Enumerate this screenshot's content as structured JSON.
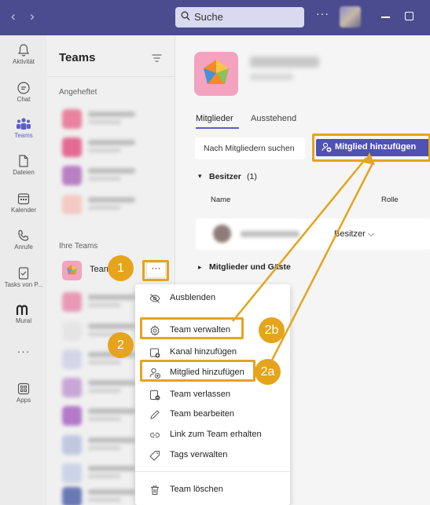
{
  "topbar": {
    "search_placeholder": "Suche",
    "more": "···"
  },
  "rail": {
    "items": [
      {
        "label": "Aktivität",
        "icon": "bell-icon"
      },
      {
        "label": "Chat",
        "icon": "chat-icon"
      },
      {
        "label": "Teams",
        "icon": "teams-icon"
      },
      {
        "label": "Dateien",
        "icon": "file-icon"
      },
      {
        "label": "Kalender",
        "icon": "calendar-icon"
      },
      {
        "label": "Anrufe",
        "icon": "phone-icon"
      },
      {
        "label": "Tasks von P...",
        "icon": "tasks-icon"
      },
      {
        "label": "Mural",
        "icon": "mural-icon"
      },
      {
        "label": "···",
        "icon": "more-icon"
      },
      {
        "label": "Apps",
        "icon": "apps-icon"
      }
    ]
  },
  "pane": {
    "title": "Teams",
    "pinned_label": "Angeheftet",
    "your_teams_label": "Ihre Teams",
    "selected_team": "Tean",
    "more_button": "···"
  },
  "main": {
    "tab_members": "Mitglieder",
    "tab_pending": "Ausstehend",
    "search_placeholder": "Nach Mitgliedern suchen",
    "add_member_button": "Mitglied hinzufügen",
    "owners_section": "Besitzer",
    "owners_count": "(1)",
    "col_name": "Name",
    "col_role": "Rolle",
    "owner_role": "Besitzer",
    "members_section": "Mitglieder und Gäste"
  },
  "menu": {
    "items": [
      {
        "label": "Ausblenden",
        "icon": "eye-off-icon"
      },
      {
        "label": "Team verwalten",
        "icon": "gear-icon"
      },
      {
        "label": "Kanal hinzufügen",
        "icon": "add-channel-icon"
      },
      {
        "label": "Mitglied hinzufügen",
        "icon": "add-person-icon"
      },
      {
        "label": "Team verlassen",
        "icon": "leave-icon"
      },
      {
        "label": "Team bearbeiten",
        "icon": "pencil-icon"
      },
      {
        "label": "Link zum Team erhalten",
        "icon": "link-icon"
      },
      {
        "label": "Tags verwalten",
        "icon": "tag-icon"
      },
      {
        "label": "Team löschen",
        "icon": "trash-icon"
      }
    ]
  },
  "annotations": {
    "badge_1": "1",
    "badge_2": "2",
    "badge_2a": "2a",
    "badge_2b": "2b",
    "accent_color": "#E5A41C"
  }
}
